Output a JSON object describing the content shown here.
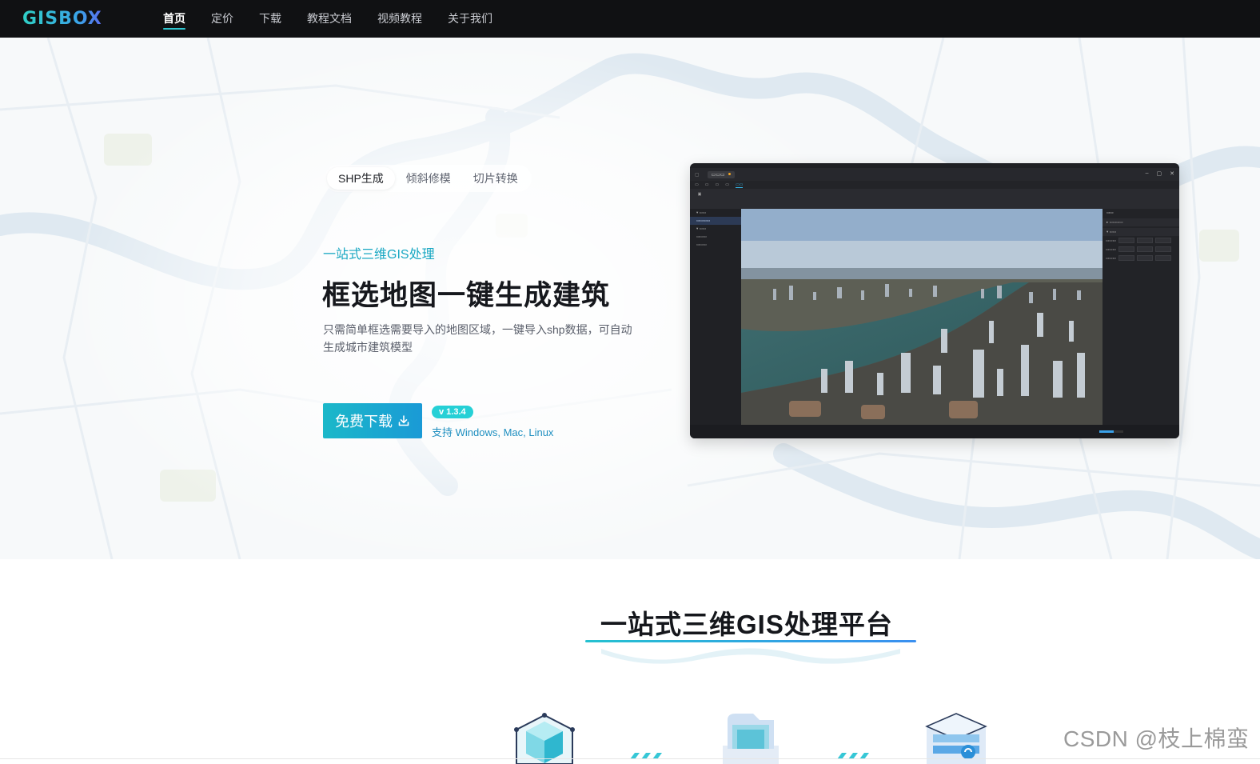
{
  "nav": {
    "logo": "GISBOX",
    "items": [
      {
        "label": "首页",
        "active": true
      },
      {
        "label": "定价",
        "active": false
      },
      {
        "label": "下载",
        "active": false
      },
      {
        "label": "教程文档",
        "active": false
      },
      {
        "label": "视频教程",
        "active": false
      },
      {
        "label": "关于我们",
        "active": false
      }
    ]
  },
  "hero": {
    "tabs": [
      {
        "label": "SHP生成",
        "active": true
      },
      {
        "label": "倾斜修模",
        "active": false
      },
      {
        "label": "切片转换",
        "active": false
      }
    ],
    "kicker": "一站式三维GIS处理",
    "headline": "框选地图一键生成建筑",
    "description": "只需简单框选需要导入的地图区域，一键导入shp数据，可自动生成城市建筑模型",
    "download_button": "免费下载",
    "download_icon": "download-icon",
    "version": "v 1.3.4",
    "platforms": "支持 Windows, Mac, Linux"
  },
  "section2": {
    "title": "一站式三维GIS处理平台"
  },
  "watermark": "CSDN @枝上棉蛮",
  "colors": {
    "accent": "#1bb8c9",
    "nav_bg": "#101113",
    "version_badge": "#26d0d6"
  }
}
